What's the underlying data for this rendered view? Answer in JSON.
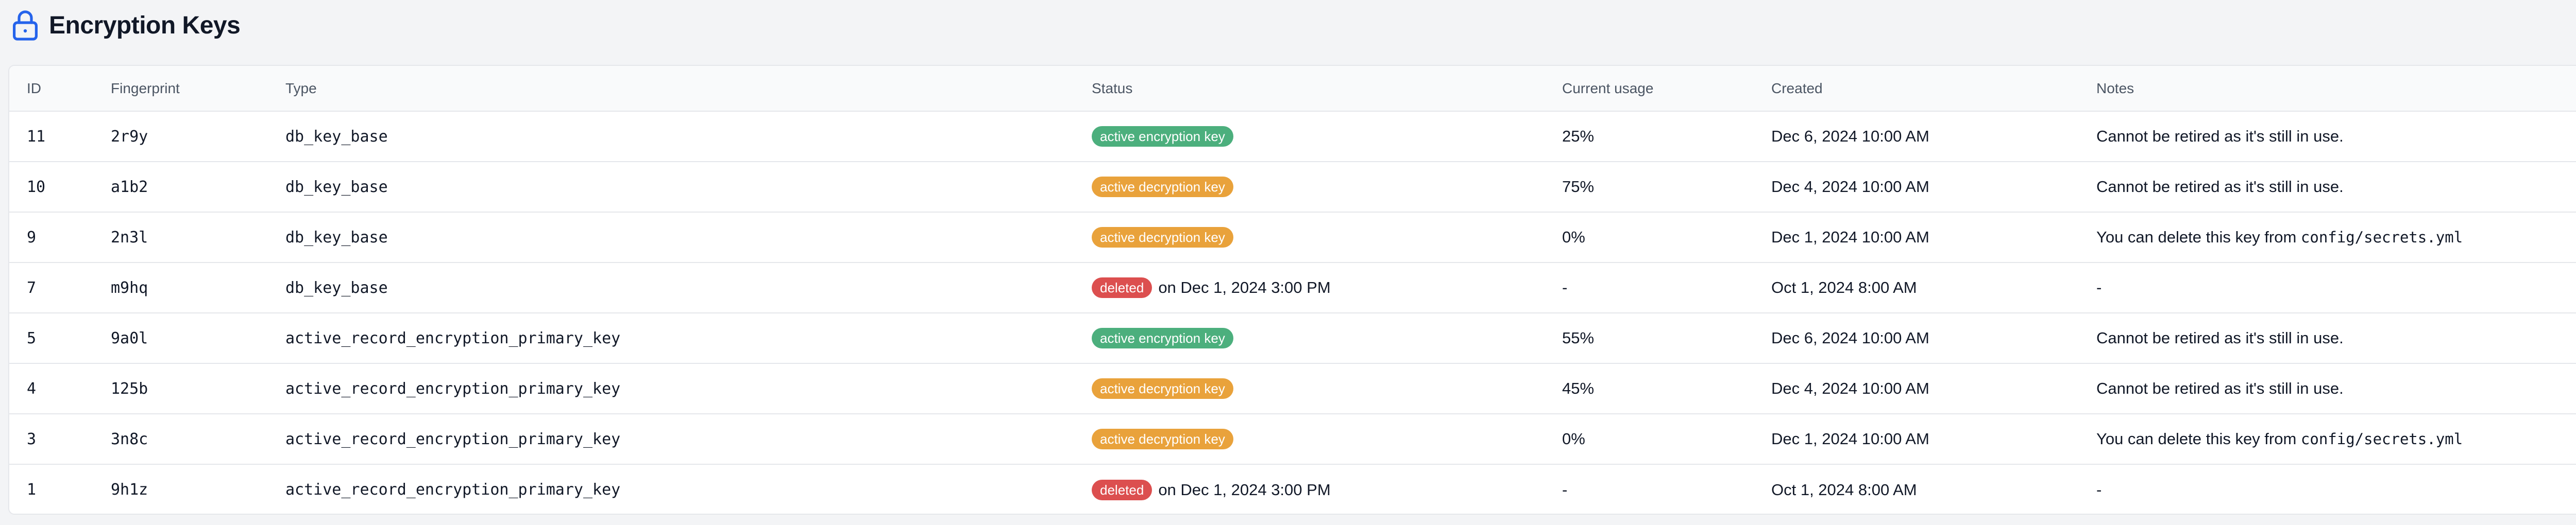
{
  "header": {
    "title": "Encryption Keys",
    "icon": "lock-icon"
  },
  "colors": {
    "accent": "#2563eb",
    "active_encryption": "#4caf7d",
    "active_decryption": "#e9a23b",
    "deleted": "#dc4f4f"
  },
  "table": {
    "columns": [
      "ID",
      "Fingerprint",
      "Type",
      "Status",
      "Current usage",
      "Created",
      "Notes"
    ],
    "rows": [
      {
        "id": "11",
        "fingerprint": "2r9y",
        "type": "db_key_base",
        "status": {
          "kind": "active_encryption",
          "label": "active encryption key",
          "suffix": ""
        },
        "usage": "25%",
        "created": "Dec 6, 2024 10:00 AM",
        "notes": {
          "text": "Cannot be retired as it's still in use.",
          "code": ""
        }
      },
      {
        "id": "10",
        "fingerprint": "a1b2",
        "type": "db_key_base",
        "status": {
          "kind": "active_decryption",
          "label": "active decryption key",
          "suffix": ""
        },
        "usage": "75%",
        "created": "Dec 4, 2024 10:00 AM",
        "notes": {
          "text": "Cannot be retired as it's still in use.",
          "code": ""
        }
      },
      {
        "id": "9",
        "fingerprint": "2n3l",
        "type": "db_key_base",
        "status": {
          "kind": "active_decryption",
          "label": "active decryption key",
          "suffix": ""
        },
        "usage": "0%",
        "created": "Dec 1, 2024 10:00 AM",
        "notes": {
          "text": "You can delete this key from ",
          "code": "config/secrets.yml"
        }
      },
      {
        "id": "7",
        "fingerprint": "m9hq",
        "type": "db_key_base",
        "status": {
          "kind": "deleted",
          "label": "deleted",
          "suffix": "on Dec 1, 2024 3:00 PM"
        },
        "usage": "-",
        "created": "Oct 1, 2024 8:00 AM",
        "notes": {
          "text": "-",
          "code": ""
        }
      },
      {
        "id": "5",
        "fingerprint": "9a0l",
        "type": "active_record_encryption_primary_key",
        "status": {
          "kind": "active_encryption",
          "label": "active encryption key",
          "suffix": ""
        },
        "usage": "55%",
        "created": "Dec 6, 2024 10:00 AM",
        "notes": {
          "text": "Cannot be retired as it's still in use.",
          "code": ""
        }
      },
      {
        "id": "4",
        "fingerprint": "125b",
        "type": "active_record_encryption_primary_key",
        "status": {
          "kind": "active_decryption",
          "label": "active decryption key",
          "suffix": ""
        },
        "usage": "45%",
        "created": "Dec 4, 2024 10:00 AM",
        "notes": {
          "text": "Cannot be retired as it's still in use.",
          "code": ""
        }
      },
      {
        "id": "3",
        "fingerprint": "3n8c",
        "type": "active_record_encryption_primary_key",
        "status": {
          "kind": "active_decryption",
          "label": "active decryption key",
          "suffix": ""
        },
        "usage": "0%",
        "created": "Dec 1, 2024 10:00 AM",
        "notes": {
          "text": "You can delete this key from ",
          "code": "config/secrets.yml"
        }
      },
      {
        "id": "1",
        "fingerprint": "9h1z",
        "type": "active_record_encryption_primary_key",
        "status": {
          "kind": "deleted",
          "label": "deleted",
          "suffix": "on Dec 1, 2024 3:00 PM"
        },
        "usage": "-",
        "created": "Oct 1, 2024 8:00 AM",
        "notes": {
          "text": "-",
          "code": ""
        }
      }
    ]
  }
}
